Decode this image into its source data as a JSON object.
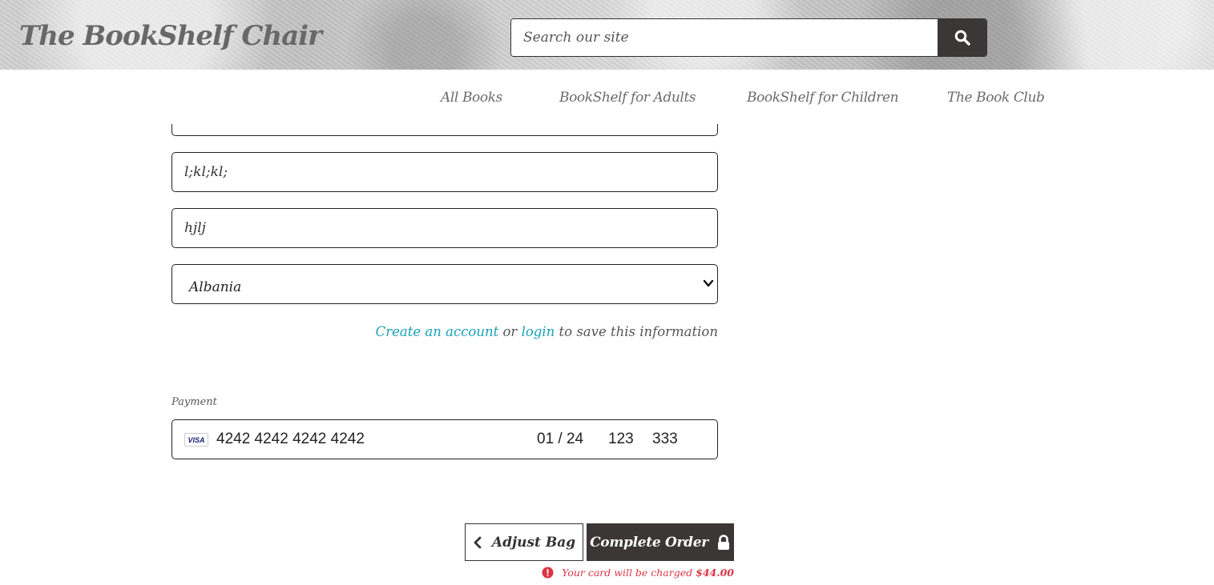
{
  "header": {
    "logo": "The BookShelf Chair",
    "search_placeholder": "Search our site",
    "search_icon": "search-icon"
  },
  "nav": {
    "items": [
      {
        "label": "All Books"
      },
      {
        "label": "BookShelf for Adults"
      },
      {
        "label": "BookShelf for Children"
      },
      {
        "label": "The Book Club"
      }
    ]
  },
  "form": {
    "field_partial_value": "",
    "field_1_value": "l;kl;kl;",
    "field_2_value": "hjlj",
    "country_value": "Albania",
    "save_info": {
      "create_account": "Create an account",
      "or": "or",
      "login": "login",
      "suffix": "to save this information"
    }
  },
  "payment": {
    "label": "Payment",
    "card_brand": "VISA",
    "card_number": "4242 4242 4242 4242",
    "expiry": "01 / 24",
    "cvc": "123",
    "postal": "333"
  },
  "actions": {
    "adjust_label": "Adjust Bag",
    "complete_label": "Complete Order",
    "charge_text": "Your card will be charged",
    "charge_amount": "$44.00"
  },
  "colors": {
    "accent_dark": "#3b3737",
    "link": "#17a2b8",
    "error": "#dc3545"
  }
}
